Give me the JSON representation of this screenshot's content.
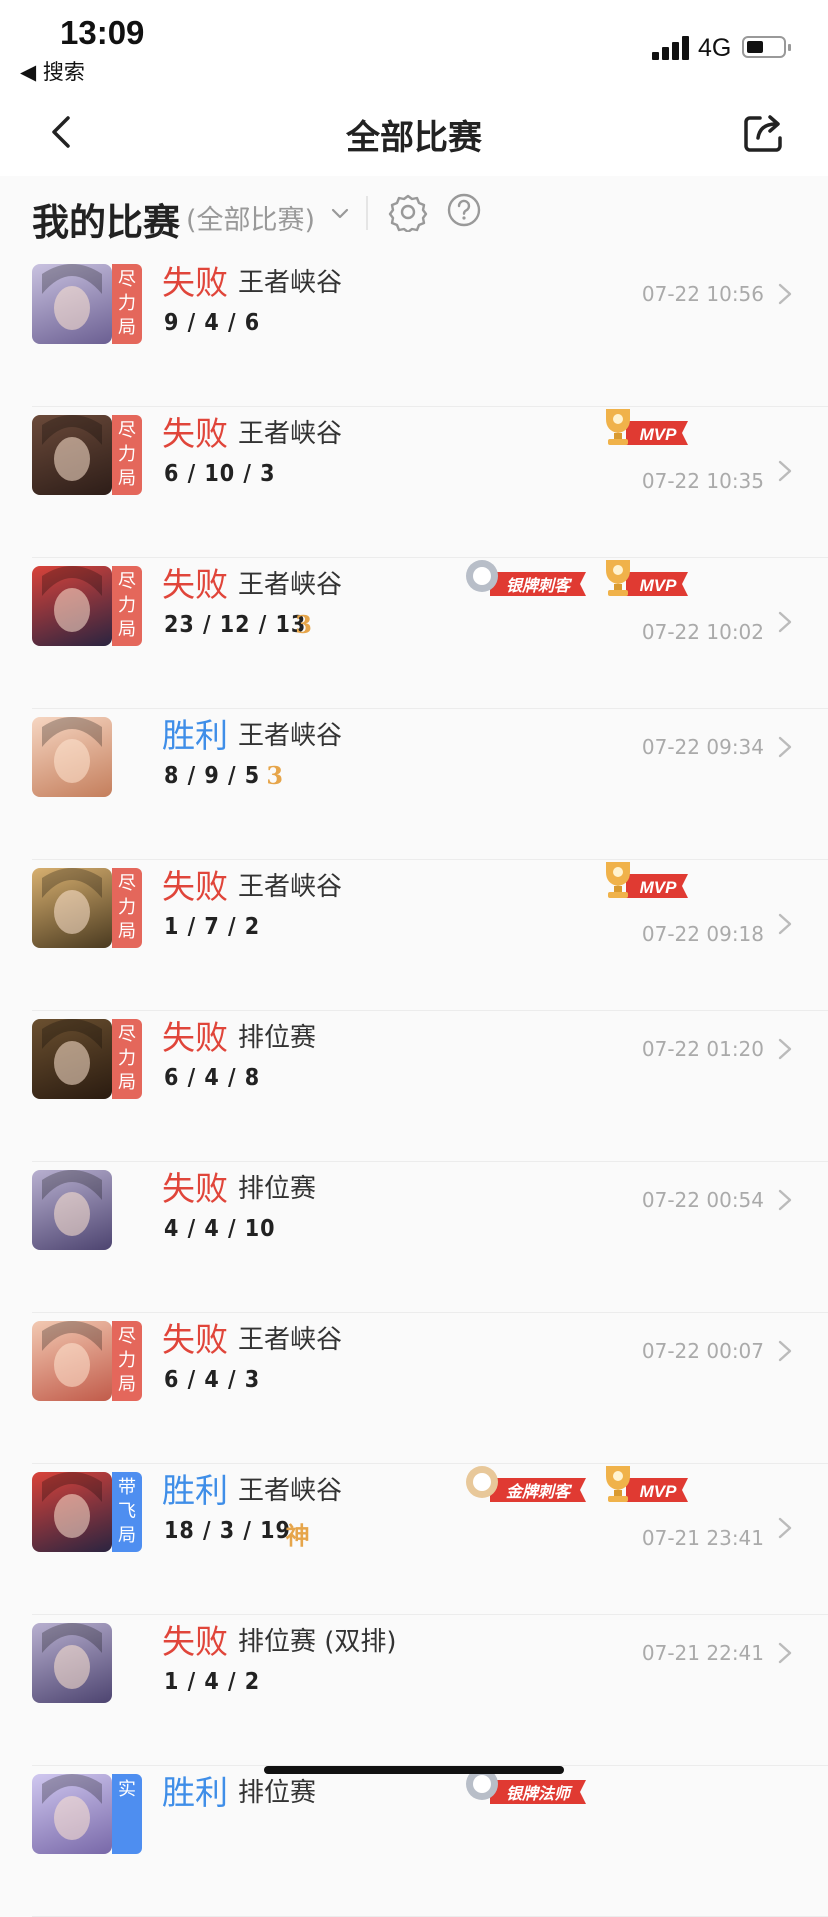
{
  "status": {
    "time": "13:09",
    "back_app": "◀ 搜索",
    "network": "4G"
  },
  "nav": {
    "title": "全部比赛"
  },
  "filter": {
    "heading": "我的比赛",
    "selected": "(全部比赛)"
  },
  "colors": {
    "lose": "#e0453a",
    "win": "#3f8ee8",
    "tag_lose": "#e4675b",
    "tag_win": "#4e8ef0",
    "mvp_red": "#e03a32",
    "gold": "#f0b24a"
  },
  "matches": [
    {
      "result": "失败",
      "mode": "王者峡谷",
      "kda": "9 / 4 / 6",
      "time": "07-22 10:56",
      "tag": "尽力局",
      "avatar": "hero-avatar-1"
    },
    {
      "result": "失败",
      "mode": "王者峡谷",
      "kda": "6 / 10 / 3",
      "time": "07-22 10:35",
      "tag": "尽力局",
      "mvp": "MVP",
      "avatar": "hero-avatar-2"
    },
    {
      "result": "失败",
      "mode": "王者峡谷",
      "kda": "23 / 12 / 13",
      "medal": "3",
      "time": "07-22 10:02",
      "tag": "尽力局",
      "mvp": "MVP",
      "pin": "银牌刺客",
      "avatar": "hero-avatar-3"
    },
    {
      "result": "胜利",
      "mode": "王者峡谷",
      "kda": "8 / 9 / 5",
      "medal": "3",
      "time": "07-22 09:34",
      "tag": "",
      "avatar": "hero-avatar-4"
    },
    {
      "result": "失败",
      "mode": "王者峡谷",
      "kda": "1 / 7 / 2",
      "time": "07-22 09:18",
      "tag": "尽力局",
      "mvp": "MVP",
      "avatar": "hero-avatar-5"
    },
    {
      "result": "失败",
      "mode": "排位赛",
      "kda": "6 / 4 / 8",
      "time": "07-22 01:20",
      "tag": "尽力局",
      "avatar": "hero-avatar-6"
    },
    {
      "result": "失败",
      "mode": "排位赛",
      "kda": "4 / 4 / 10",
      "time": "07-22 00:54",
      "tag": "",
      "avatar": "hero-avatar-7"
    },
    {
      "result": "失败",
      "mode": "王者峡谷",
      "kda": "6 / 4 / 3",
      "time": "07-22 00:07",
      "tag": "尽力局",
      "avatar": "hero-avatar-8"
    },
    {
      "result": "胜利",
      "mode": "王者峡谷",
      "kda": "18 / 3 / 19",
      "medal": "神",
      "time": "07-21 23:41",
      "tag": "带飞局",
      "mvp": "MVP",
      "pin": "金牌刺客",
      "avatar": "hero-avatar-9"
    },
    {
      "result": "失败",
      "mode": "排位赛 (双排)",
      "kda": "1 / 4 / 2",
      "time": "07-21 22:41",
      "tag": "",
      "avatar": "hero-avatar-10"
    },
    {
      "result": "胜利",
      "mode": "排位赛",
      "kda": "",
      "time": "",
      "tag": "实",
      "pin": "银牌法师",
      "avatar": "hero-avatar-11"
    }
  ]
}
